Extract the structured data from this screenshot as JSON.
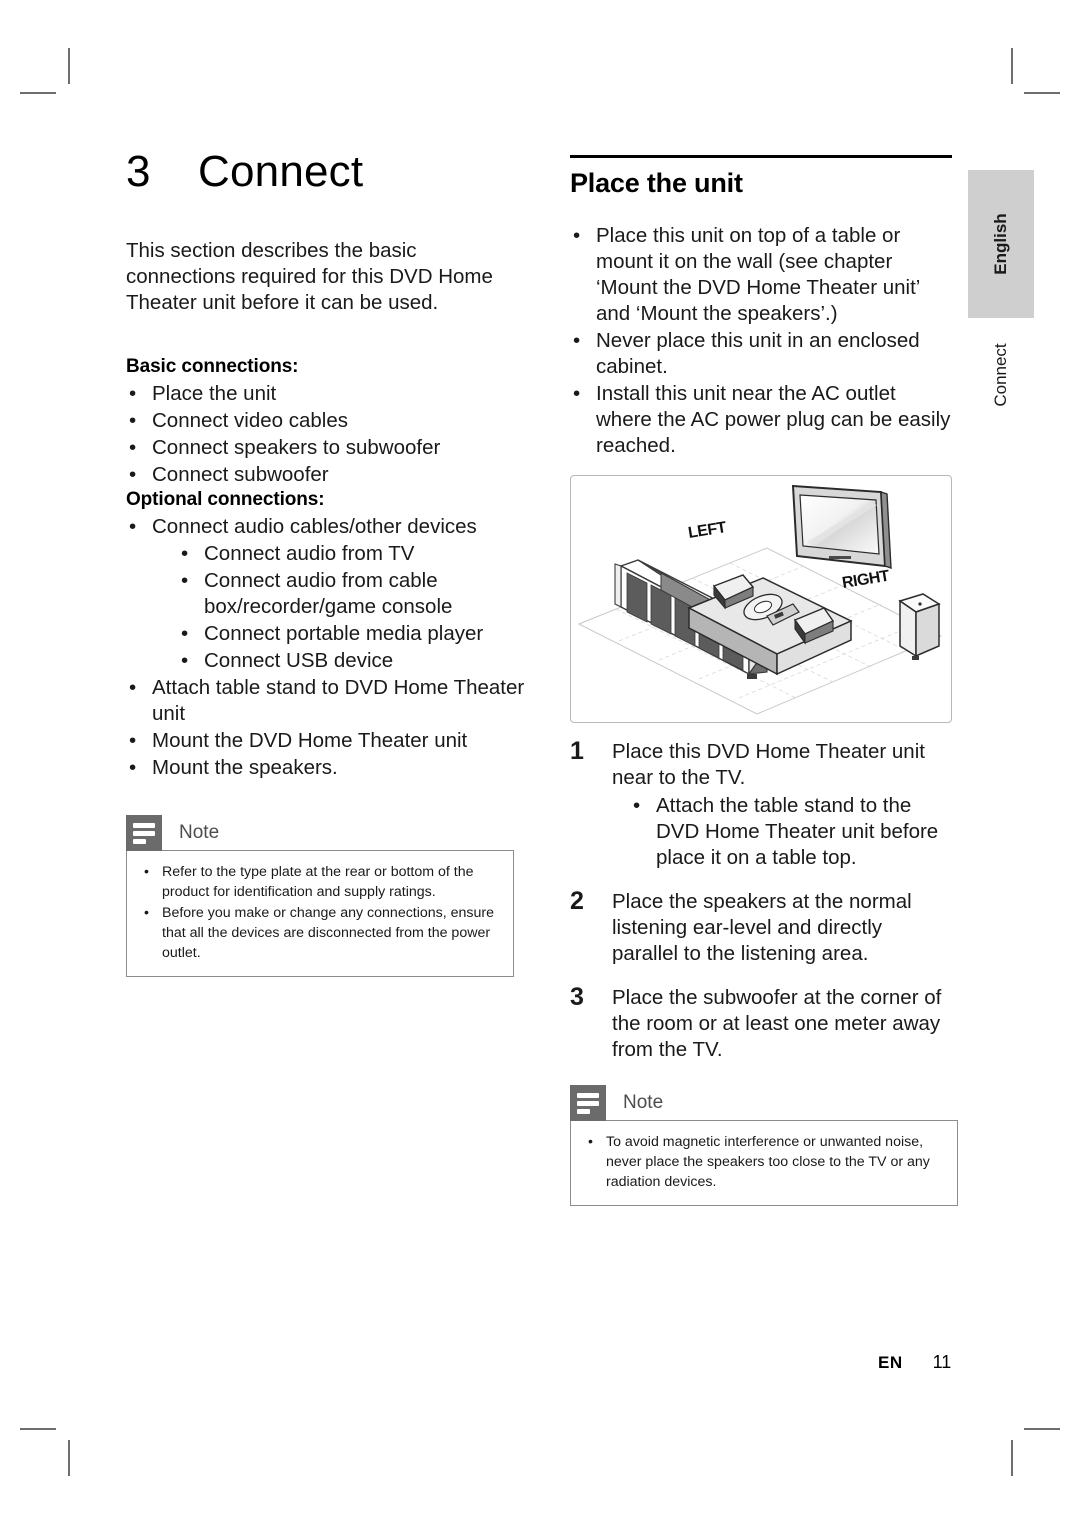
{
  "page": {
    "footer_lang": "EN",
    "footer_number": "11"
  },
  "side_tab": {
    "language": "English",
    "chapter": "Connect",
    "bg_color": "#cfcfcf"
  },
  "left_column": {
    "chapter_number": "3",
    "chapter_title": "Connect",
    "intro": "This section describes the basic connections required for this DVD Home Theater unit before it can be used.",
    "basic_heading": "Basic connections:",
    "basic_items": [
      "Place the unit",
      "Connect video cables",
      "Connect speakers to subwoofer",
      "Connect subwoofer"
    ],
    "optional_heading": "Optional connections:",
    "optional_items": [
      "Connect audio cables/other devices"
    ],
    "optional_sub_items": [
      "Connect audio from TV",
      "Connect audio from cable box/recorder/game console",
      "Connect portable media player",
      "Connect USB device"
    ],
    "optional_items_tail": [
      "Attach table stand to DVD Home Theater unit",
      "Mount the DVD Home Theater unit",
      "Mount the speakers."
    ],
    "note": {
      "title": "Note",
      "icon": "note-lines-icon",
      "items": [
        "Refer to the type plate at the rear or bottom of the product for identification and supply ratings.",
        "Before you make or change any connections, ensure that all the devices are disconnected from the power outlet."
      ]
    }
  },
  "right_column": {
    "section_title": "Place the unit",
    "bullets": [
      "Place this unit on top of a table or mount it on the wall (see chapter ‘Mount the DVD Home Theater unit’ and ‘Mount the speakers’.)",
      "Never place this unit in an enclosed cabinet.",
      "Install this unit near the AC outlet where the AC power plug can be easily reached."
    ],
    "illustration": {
      "name": "room-placement-diagram",
      "label_left": "LEFT",
      "label_right": "RIGHT"
    },
    "steps": [
      {
        "number": "1",
        "text": "Place this DVD Home Theater unit near to the TV.",
        "sub": [
          "Attach the table stand to the DVD Home Theater unit before place it on a table top."
        ]
      },
      {
        "number": "2",
        "text": "Place the speakers at the normal listening ear-level and directly parallel to the listening area.",
        "sub": []
      },
      {
        "number": "3",
        "text": "Place the subwoofer at the corner of the room or at least one meter away from the TV.",
        "sub": []
      }
    ],
    "note": {
      "title": "Note",
      "icon": "note-lines-icon",
      "items": [
        "To avoid magnetic interference or unwanted noise, never place the speakers too close to the TV or any radiation devices."
      ]
    }
  }
}
